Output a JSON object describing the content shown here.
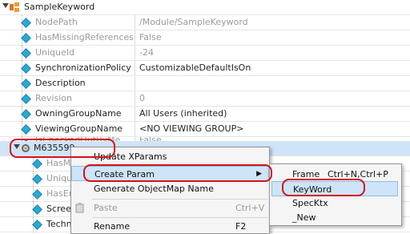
{
  "root": {
    "name": "SampleKeyword"
  },
  "props": [
    {
      "name": "NodePath",
      "value": "/Module/SampleKeyword",
      "readonly": true
    },
    {
      "name": "HasMissingReferences",
      "value": "False",
      "readonly": true
    },
    {
      "name": "UniqueId",
      "value": "-24",
      "readonly": true
    },
    {
      "name": "SynchronizationPolicy",
      "value": "CustomizableDefaultIsOn",
      "readonly": false
    },
    {
      "name": "Description",
      "value": "",
      "readonly": false
    },
    {
      "name": "Revision",
      "value": "0",
      "readonly": true
    },
    {
      "name": "OwningGroupName",
      "value": "All Users (inherited)",
      "readonly": false
    },
    {
      "name": "ViewingGroupName",
      "value": "<NO VIEWING GROUP>",
      "readonly": false
    },
    {
      "name": "IsCheckedOutByMe",
      "value": "False",
      "readonly": true
    }
  ],
  "child": {
    "name": "M635599"
  },
  "child_props": [
    {
      "name": "HasM",
      "readonly": true
    },
    {
      "name": "Uniqu",
      "readonly": true
    },
    {
      "name": "HasEr",
      "readonly": true
    },
    {
      "name": "Screen",
      "readonly": false
    },
    {
      "name": "Techn",
      "readonly": false
    }
  ],
  "context_menu": {
    "update_label": "Update XParams",
    "create_param_label": "Create Param",
    "generate_label": "Generate ObjectMap Name",
    "paste_label": "Paste",
    "paste_shortcut": "Ctrl+V",
    "rename_label": "Rename",
    "rename_shortcut": "F2"
  },
  "submenu": {
    "frame_label": "Frame",
    "frame_shortcut": "Ctrl+N,Ctrl+P",
    "keyword_label": "KeyWord",
    "specktx_label": "SpecKtx",
    "new_label": "_New"
  },
  "colors": {
    "accent": "#d6101c",
    "diamond": "#2aa9d4",
    "highlight": "#cde5f8"
  }
}
